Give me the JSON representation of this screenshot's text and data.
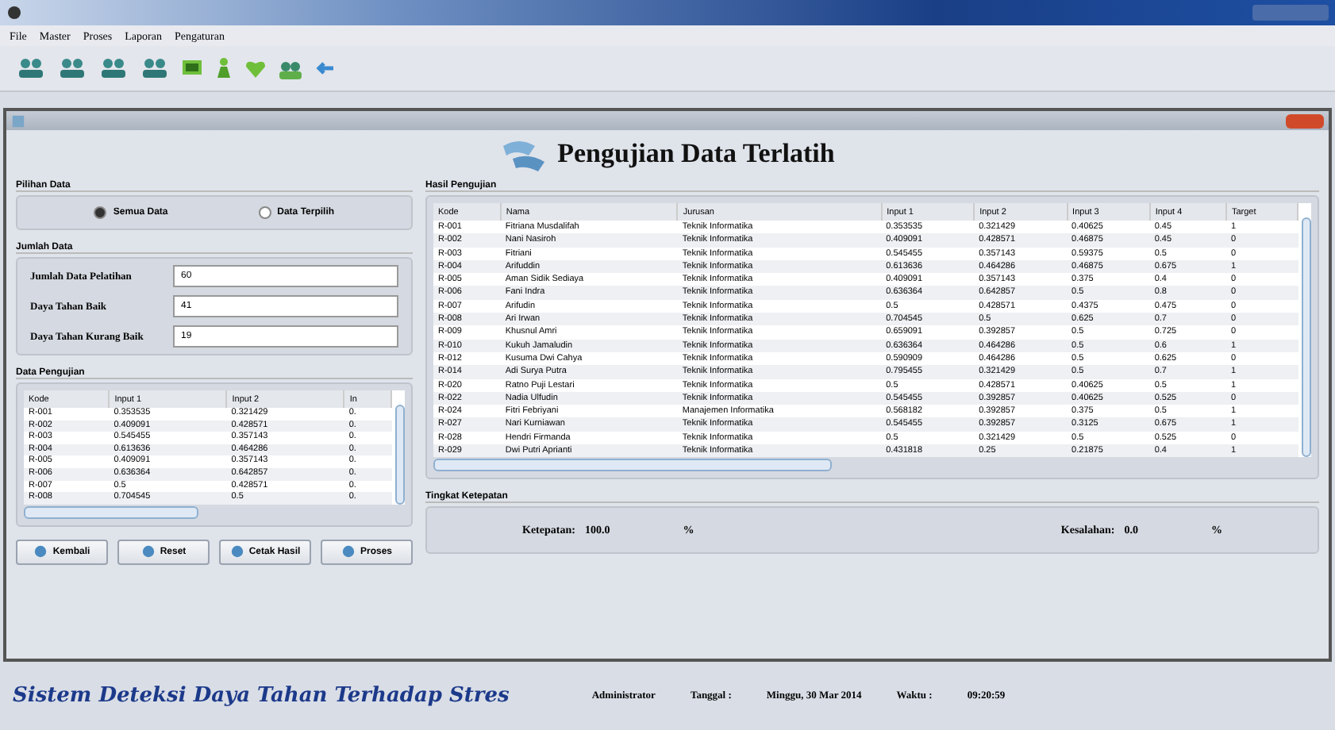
{
  "menu": [
    "File",
    "Master",
    "Proses",
    "Laporan",
    "Pengaturan"
  ],
  "header": {
    "title": "Pengujian Data Terlatih"
  },
  "pilihan_data": {
    "title": "Pilihan Data",
    "options": [
      {
        "label": "Semua Data",
        "selected": true
      },
      {
        "label": "Data Terpilih",
        "selected": false
      }
    ]
  },
  "jumlah_data": {
    "title": "Jumlah Data",
    "fields": [
      {
        "label": "Jumlah Data Pelatihan",
        "value": "60"
      },
      {
        "label": "Daya Tahan Baik",
        "value": "41"
      },
      {
        "label": "Daya Tahan Kurang Baik",
        "value": "19"
      }
    ]
  },
  "data_pengujian": {
    "title": "Data Pengujian",
    "columns": [
      "Kode",
      "Input 1",
      "Input 2",
      "In"
    ],
    "rows": [
      [
        "R-001",
        "0.353535",
        "0.321429",
        "0."
      ],
      [
        "R-002",
        "0.409091",
        "0.428571",
        "0."
      ],
      [
        "R-003",
        "0.545455",
        "0.357143",
        "0."
      ],
      [
        "R-004",
        "0.613636",
        "0.464286",
        "0."
      ],
      [
        "R-005",
        "0.409091",
        "0.357143",
        "0."
      ],
      [
        "R-006",
        "0.636364",
        "0.642857",
        "0."
      ],
      [
        "R-007",
        "0.5",
        "0.428571",
        "0."
      ],
      [
        "R-008",
        "0.704545",
        "0.5",
        "0."
      ]
    ]
  },
  "buttons": [
    "Kembali",
    "Reset",
    "Cetak Hasil",
    "Proses"
  ],
  "hasil_pengujian": {
    "title": "Hasil Pengujian",
    "columns": [
      "Kode",
      "Nama",
      "Jurusan",
      "Input 1",
      "Input 2",
      "Input 3",
      "Input 4",
      "Target"
    ],
    "rows": [
      [
        "R-001",
        "Fitriana Musdalifah",
        "Teknik Informatika",
        "0.353535",
        "0.321429",
        "0.40625",
        "0.45",
        "1"
      ],
      [
        "R-002",
        "Nani Nasiroh",
        "Teknik Informatika",
        "0.409091",
        "0.428571",
        "0.46875",
        "0.45",
        "0"
      ],
      [
        "R-003",
        "Fitriani",
        "Teknik Informatika",
        "0.545455",
        "0.357143",
        "0.59375",
        "0.5",
        "0"
      ],
      [
        "R-004",
        "Arifuddin",
        "Teknik Informatika",
        "0.613636",
        "0.464286",
        "0.46875",
        "0.675",
        "1"
      ],
      [
        "R-005",
        "Aman Sidik Sediaya",
        "Teknik Informatika",
        "0.409091",
        "0.357143",
        "0.375",
        "0.4",
        "0"
      ],
      [
        "R-006",
        "Fani Indra",
        "Teknik Informatika",
        "0.636364",
        "0.642857",
        "0.5",
        "0.8",
        "0"
      ],
      [
        "R-007",
        "Arifudin",
        "Teknik Informatika",
        "0.5",
        "0.428571",
        "0.4375",
        "0.475",
        "0"
      ],
      [
        "R-008",
        "Ari Irwan",
        "Teknik Informatika",
        "0.704545",
        "0.5",
        "0.625",
        "0.7",
        "0"
      ],
      [
        "R-009",
        "Khusnul Amri",
        "Teknik Informatika",
        "0.659091",
        "0.392857",
        "0.5",
        "0.725",
        "0"
      ],
      [
        "R-010",
        "Kukuh Jamaludin",
        "Teknik Informatika",
        "0.636364",
        "0.464286",
        "0.5",
        "0.6",
        "1"
      ],
      [
        "R-012",
        "Kusuma Dwi Cahya",
        "Teknik Informatika",
        "0.590909",
        "0.464286",
        "0.5",
        "0.625",
        "0"
      ],
      [
        "R-014",
        "Adi Surya Putra",
        "Teknik Informatika",
        "0.795455",
        "0.321429",
        "0.5",
        "0.7",
        "1"
      ],
      [
        "R-020",
        "Ratno Puji Lestari",
        "Teknik Informatika",
        "0.5",
        "0.428571",
        "0.40625",
        "0.5",
        "1"
      ],
      [
        "R-022",
        "Nadia Ulfudin",
        "Teknik Informatika",
        "0.545455",
        "0.392857",
        "0.40625",
        "0.525",
        "0"
      ],
      [
        "R-024",
        "Fitri Febriyani",
        "Manajemen Informatika",
        "0.568182",
        "0.392857",
        "0.375",
        "0.5",
        "1"
      ],
      [
        "R-027",
        "Nari Kurniawan",
        "Teknik Informatika",
        "0.545455",
        "0.392857",
        "0.3125",
        "0.675",
        "1"
      ],
      [
        "R-028",
        "Hendri Firmanda",
        "Teknik Informatika",
        "0.5",
        "0.321429",
        "0.5",
        "0.525",
        "0"
      ],
      [
        "R-029",
        "Dwi Putri Aprianti",
        "Teknik Informatika",
        "0.431818",
        "0.25",
        "0.21875",
        "0.4",
        "1"
      ]
    ]
  },
  "tingkat_ketepatan": {
    "title": "Tingkat Ketepatan",
    "ketepatan_label": "Ketepatan:",
    "ketepatan_value": "100.0",
    "ketepatan_unit": "%",
    "kesalahan_label": "Kesalahan:",
    "kesalahan_value": "0.0",
    "kesalahan_unit": "%"
  },
  "footer": {
    "app_name": "Sistem Deteksi Daya Tahan Terhadap Stres",
    "user": "Administrator",
    "date_label": "Tanggal :",
    "date": "Minggu, 30 Mar 2014",
    "time_label": "Waktu :",
    "time": "09:20:59"
  }
}
